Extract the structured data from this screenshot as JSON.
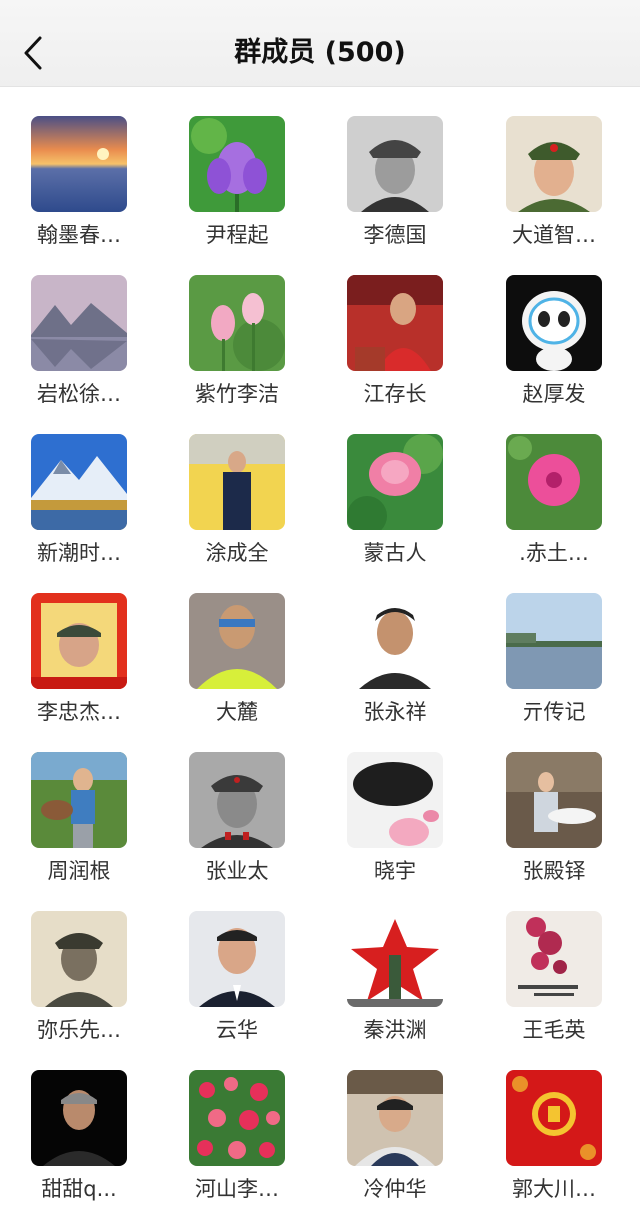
{
  "header": {
    "title": "群成员 (500)",
    "back_icon": "chevron-left-icon"
  },
  "members": [
    {
      "name": "翰墨春…",
      "avatar": "sunset-sea"
    },
    {
      "name": "尹程起",
      "avatar": "purple-lotus"
    },
    {
      "name": "李德国",
      "avatar": "bw-soldier-portrait"
    },
    {
      "name": "大道智…",
      "avatar": "soldier-portrait"
    },
    {
      "name": "岩松徐…",
      "avatar": "mountain-lake"
    },
    {
      "name": "紫竹李洁",
      "avatar": "lotus-buds"
    },
    {
      "name": "江存长",
      "avatar": "man-red-shirt"
    },
    {
      "name": "赵厚发",
      "avatar": "panda-mascot"
    },
    {
      "name": "新潮时…",
      "avatar": "snow-mountain"
    },
    {
      "name": "涂成全",
      "avatar": "man-flower-field"
    },
    {
      "name": "蒙古人",
      "avatar": "pink-lotus"
    },
    {
      "name": ".赤土…",
      "avatar": "pink-hibiscus"
    },
    {
      "name": "李忠杰…",
      "avatar": "red-frame-portrait"
    },
    {
      "name": "大麓",
      "avatar": "man-yellow-shirt"
    },
    {
      "name": "张永祥",
      "avatar": "man-portrait"
    },
    {
      "name": "亓传记",
      "avatar": "lake-view"
    },
    {
      "name": "周润根",
      "avatar": "man-with-horse"
    },
    {
      "name": "张业太",
      "avatar": "bw-soldier-portrait-2"
    },
    {
      "name": "晓宇",
      "avatar": "lotus-dark-bowl"
    },
    {
      "name": "张殿铎",
      "avatar": "woman-cafe"
    },
    {
      "name": "弥乐先…",
      "avatar": "bw-soldier-portrait-3"
    },
    {
      "name": "云华",
      "avatar": "man-suit-portrait"
    },
    {
      "name": "秦洪渊",
      "avatar": "red-star-monument"
    },
    {
      "name": "王毛英",
      "avatar": "wisteria-poem"
    },
    {
      "name": "甜甜q...",
      "avatar": "man-black-bg"
    },
    {
      "name": "河山李…",
      "avatar": "red-flowers"
    },
    {
      "name": "冷仲华",
      "avatar": "man-in-chair"
    },
    {
      "name": "郭大川…",
      "avatar": "chinese-new-year-fu"
    }
  ]
}
